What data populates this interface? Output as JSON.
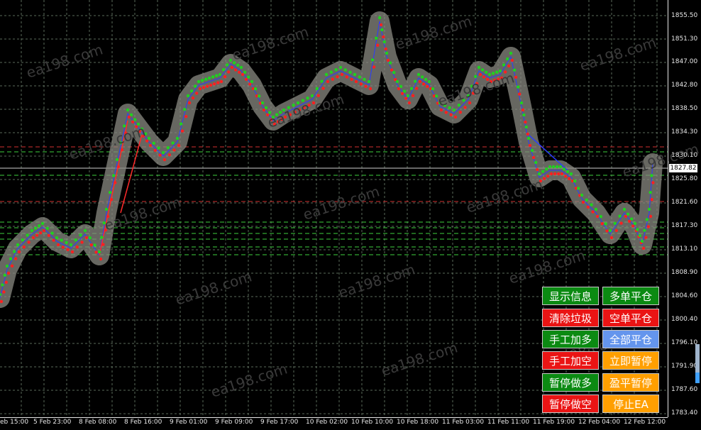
{
  "watermark": "ea198.com",
  "price_axis": {
    "labels": [
      "1855.50",
      "1851.30",
      "1847.00",
      "1842.80",
      "1838.50",
      "1834.30",
      "1830.10",
      "1825.80",
      "1821.60",
      "1817.30",
      "1813.10",
      "1808.90",
      "1804.60",
      "1800.40",
      "1796.10",
      "1791.90",
      "1787.60",
      "1783.40"
    ],
    "current_price": "1827.82"
  },
  "time_axis": {
    "labels": [
      "eb 15:00",
      "5 Feb 23:00",
      "8 Feb 08:00",
      "8 Feb 16:00",
      "9 Feb 01:00",
      "9 Feb 09:00",
      "9 Feb 17:00",
      "10 Feb 02:00",
      "10 Feb 10:00",
      "10 Feb 18:00",
      "11 Feb 03:00",
      "11 Feb 11:00",
      "11 Feb 19:00",
      "12 Feb 04:00",
      "12 Feb 12:00"
    ]
  },
  "panel": {
    "buttons": [
      {
        "label": "显示信息",
        "color": "green"
      },
      {
        "label": "多单平仓",
        "color": "green"
      },
      {
        "label": "清除垃圾",
        "color": "red"
      },
      {
        "label": "空单平仓",
        "color": "red"
      },
      {
        "label": "手工加多",
        "color": "green"
      },
      {
        "label": "全部平仓",
        "color": "blue"
      },
      {
        "label": "手工加空",
        "color": "red"
      },
      {
        "label": "立即暂停",
        "color": "orange"
      },
      {
        "label": "暂停做多",
        "color": "green"
      },
      {
        "label": "盈平暂停",
        "color": "orange"
      },
      {
        "label": "暂停做空",
        "color": "red"
      },
      {
        "label": "停止EA",
        "color": "orange"
      }
    ]
  },
  "colors": {
    "background": "#000000",
    "grid": "#5a6a5a",
    "trail": "#8a8a82",
    "buy_marker": "#1fd21f",
    "sell_marker": "#ff2020",
    "red_line": "#ff2a2a",
    "blue_line": "#2a3cff",
    "green_dash": "#3ecf3e",
    "red_dash": "#d43030"
  }
}
